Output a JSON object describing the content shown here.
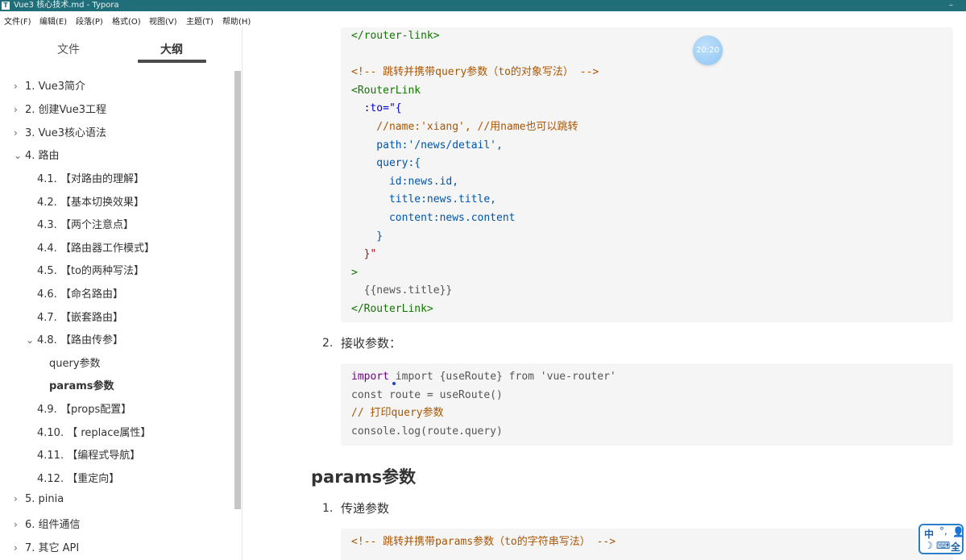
{
  "window": {
    "title": "Vue3 核心技术.md - Typora",
    "minimize": "–"
  },
  "menubar": {
    "items": [
      "文件(F)",
      "编辑(E)",
      "段落(P)",
      "格式(O)",
      "视图(V)",
      "主题(T)",
      "帮助(H)"
    ]
  },
  "sidebar": {
    "tabs": [
      "文件",
      "大纲"
    ],
    "outline": [
      {
        "label": "1. Vue3简介",
        "level": 1,
        "expanded": false
      },
      {
        "label": "2. 创建Vue3工程",
        "level": 1,
        "expanded": false
      },
      {
        "label": "3. Vue3核心语法",
        "level": 1,
        "expanded": false
      },
      {
        "label": "4. 路由",
        "level": 1,
        "expanded": true
      },
      {
        "label": "4.1. 【对路由的理解】",
        "level": 2
      },
      {
        "label": "4.2. 【基本切换效果】",
        "level": 2
      },
      {
        "label": "4.3. 【两个注意点】",
        "level": 2
      },
      {
        "label": "4.4. 【路由器工作模式】",
        "level": 2
      },
      {
        "label": "4.5. 【to的两种写法】",
        "level": 2
      },
      {
        "label": "4.6. 【命名路由】",
        "level": 2
      },
      {
        "label": "4.7. 【嵌套路由】",
        "level": 2
      },
      {
        "label": "4.8. 【路由传参】",
        "level": 2,
        "expanded": true
      },
      {
        "label": "query参数",
        "level": 3
      },
      {
        "label": "params参数",
        "level": 3,
        "active": true
      },
      {
        "label": "4.9. 【props配置】",
        "level": 2
      },
      {
        "label": "4.10. 【 replace属性】",
        "level": 2
      },
      {
        "label": "4.11. 【编程式导航】",
        "level": 2
      },
      {
        "label": "4.12. 【重定向】",
        "level": 2
      },
      {
        "label": "5. pinia",
        "level": 1,
        "expanded": false
      },
      {
        "label": "6. 组件通信",
        "level": 1,
        "expanded": false
      },
      {
        "label": "7. 其它 API",
        "level": 1,
        "expanded": false
      }
    ]
  },
  "content": {
    "code_block_1": [
      "</router-link>",
      "",
      "<!-- 跳转并携带query参数（to的对象写法） -->",
      "<RouterLink",
      "  :to=\"{",
      "    //name:'xiang', //用name也可以跳转",
      "    path:'/news/detail',",
      "    query:{",
      "      id:news.id,",
      "      title:news.title,",
      "      content:news.content",
      "    }",
      "  }\"",
      ">",
      "  {{news.title}}",
      "</RouterLink>"
    ],
    "list_item_2": {
      "number": "2.",
      "text": "接收参数："
    },
    "code_block_2": [
      "import {useRoute} from 'vue-router'",
      "const route = useRoute()",
      "// 打印query参数",
      "console.log(route.query)"
    ],
    "heading": "params参数",
    "list_item_1": {
      "number": "1.",
      "text": "传递参数"
    },
    "code_block_3": [
      "<!-- 跳转并携带params参数（to的字符串写法） -->"
    ],
    "timer_badge": "20:20",
    "ime": {
      "a": "中",
      "b": "°,",
      "c": "👤",
      "d": "☽",
      "e": "⌨",
      "f": "全"
    }
  }
}
